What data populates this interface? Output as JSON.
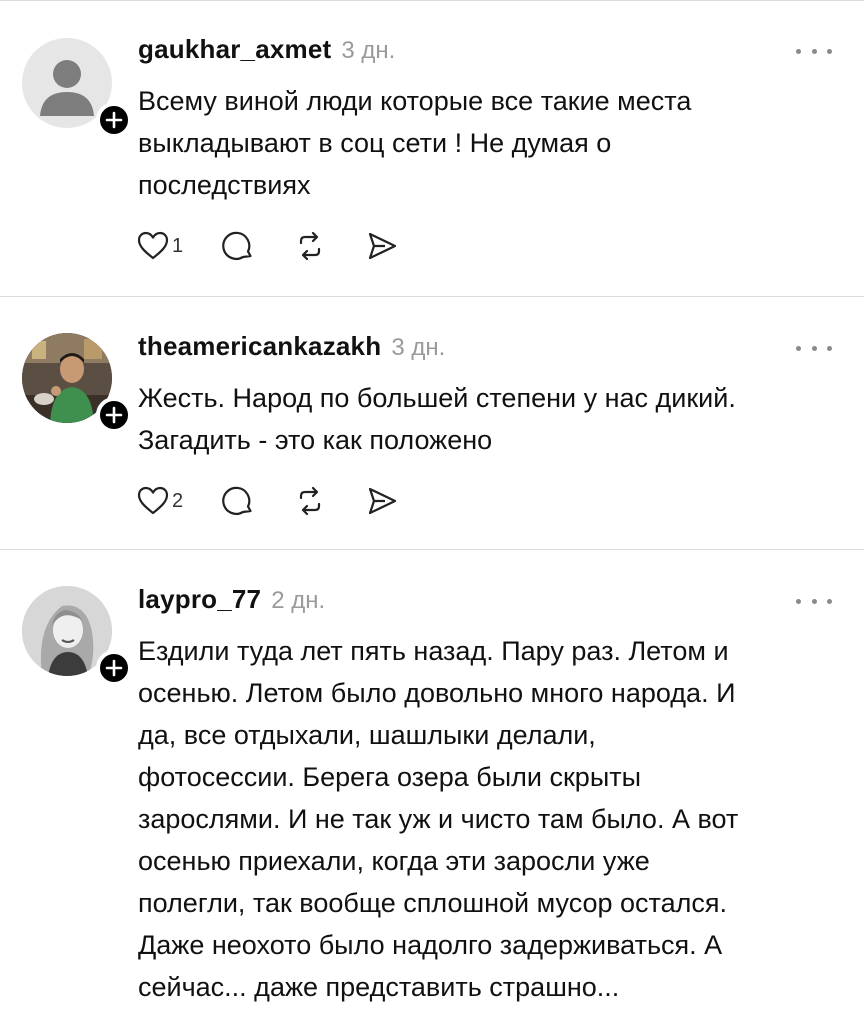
{
  "comments": [
    {
      "username": "gaukhar_axmet",
      "time": "3 дн.",
      "lines": [
        "Всему виной люди которые все такие места",
        "выкладывают в соц сети ! Не думая о",
        "последствиях"
      ],
      "likes": "1",
      "avatar": "default-person-icon"
    },
    {
      "username": "theamericankazakh",
      "time": "3 дн.",
      "lines": [
        "Жесть. Народ по большей степени у нас дикий.",
        "Загадить - это как положено"
      ],
      "likes": "2",
      "avatar": "photo-man"
    },
    {
      "username": "laypro_77",
      "time": "2 дн.",
      "lines": [
        "Ездили туда лет пять назад. Пару раз. Летом  и",
        "осенью. Летом было довольно много народа. И",
        "да, все отдыхали, шашлыки делали,",
        "фотосессии. Берега озера были скрыты",
        "зарослями. И не так уж и чисто там было. А вот",
        "осенью приехали, когда эти заросли уже",
        "полегли, так вообще сплошной мусор остался.",
        "Даже неохото было надолго задерживаться. А",
        "сейчас... даже представить страшно..."
      ],
      "avatar": "photo-woman"
    }
  ],
  "icons": {
    "like": "heart-icon",
    "reply": "comment-bubble-icon",
    "repost": "repost-icon",
    "share": "send-icon",
    "more": "more-dots-icon",
    "follow": "plus-icon"
  }
}
